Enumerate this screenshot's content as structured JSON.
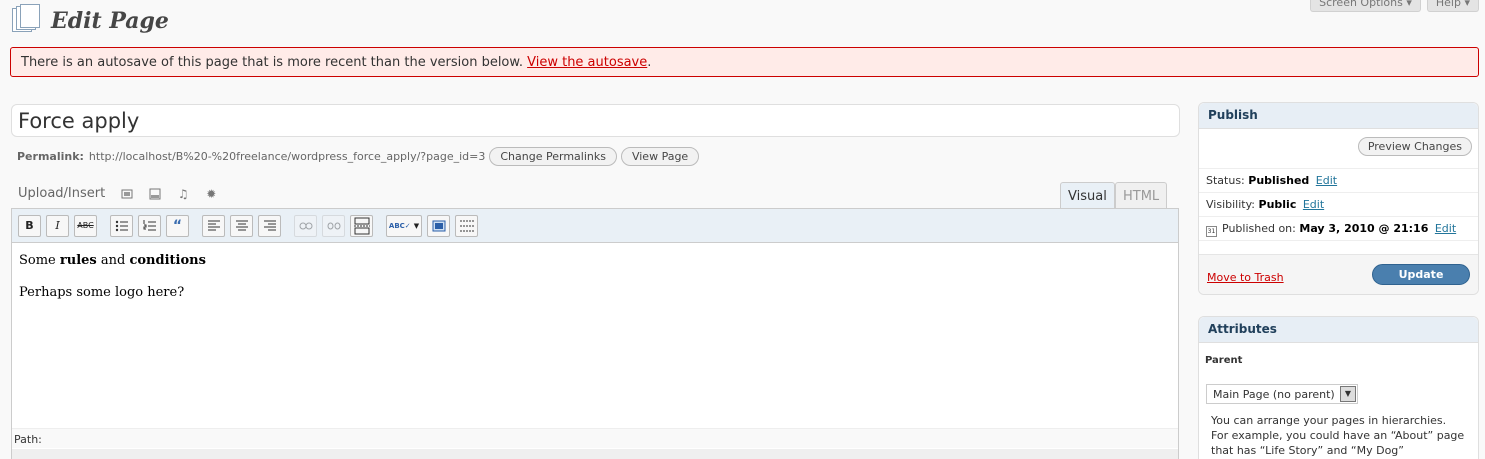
{
  "header": {
    "title": "Edit Page",
    "screen_options_label": "Screen Options ▾",
    "help_label": "Help ▾"
  },
  "notice": {
    "text": "There is an autosave of this page that is more recent than the version below.",
    "link_text": "View the autosave",
    "suffix": "."
  },
  "post": {
    "title_value": "Force apply"
  },
  "permalink": {
    "label": "Permalink:",
    "url": "http://localhost/B%20-%20freelance/wordpress_force_apply/?page_id=3",
    "change_button": "Change Permalinks",
    "view_button": "View Page"
  },
  "editor": {
    "upload_label": "Upload/Insert",
    "tabs": [
      {
        "label": "Visual"
      },
      {
        "label": "HTML"
      }
    ],
    "content": {
      "line1_prefix": "Some ",
      "line1_bold1": "rules",
      "line1_mid": " and ",
      "line1_bold2": "conditions",
      "line2": "Perhaps some logo here?"
    },
    "path_label": "Path:"
  },
  "publish": {
    "heading": "Publish",
    "preview_button": "Preview Changes",
    "status_label": "Status:",
    "status_value": "Published",
    "visibility_label": "Visibility:",
    "visibility_value": "Public",
    "published_on_label": "Published on:",
    "published_on_value": "May 3, 2010 @ 21:16",
    "edit_link": "Edit",
    "trash_link": "Move to Trash",
    "update_button": "Update"
  },
  "attributes": {
    "heading": "Attributes",
    "parent_label": "Parent",
    "parent_select_value": "Main Page (no parent)",
    "description": "You can arrange your pages in hierarchies. For example, you could have an “About” page that has “Life Story” and “My Dog”"
  }
}
